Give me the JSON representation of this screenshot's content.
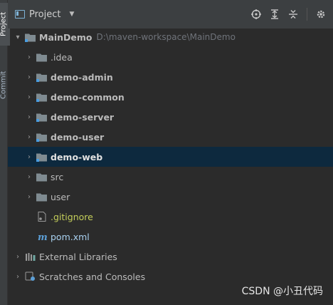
{
  "sidebar": {
    "tabs": [
      {
        "label": "Project"
      },
      {
        "label": "Commit"
      }
    ]
  },
  "header": {
    "title": "Project",
    "actions": [
      "locate-icon",
      "expand-all-icon",
      "collapse-all-icon",
      "settings-icon"
    ]
  },
  "tree": [
    {
      "label": "MainDemo",
      "path": "D:\\maven-workspace\\MainDemo",
      "expanded": true
    },
    {
      "label": ".idea"
    },
    {
      "label": "demo-admin"
    },
    {
      "label": "demo-common"
    },
    {
      "label": "demo-server"
    },
    {
      "label": "demo-user"
    },
    {
      "label": "demo-web",
      "selected": true
    },
    {
      "label": "src"
    },
    {
      "label": "user"
    },
    {
      "label": ".gitignore"
    },
    {
      "label": "pom.xml"
    },
    {
      "label": "External Libraries"
    },
    {
      "label": "Scratches and Consoles"
    }
  ],
  "watermark": "CSDN @小丑代码",
  "colors": {
    "background": "#2b2b2b",
    "header": "#3c3f41",
    "selection": "#0d293e",
    "folder": "#7f8b91",
    "module_marker": "#4a9de0"
  }
}
